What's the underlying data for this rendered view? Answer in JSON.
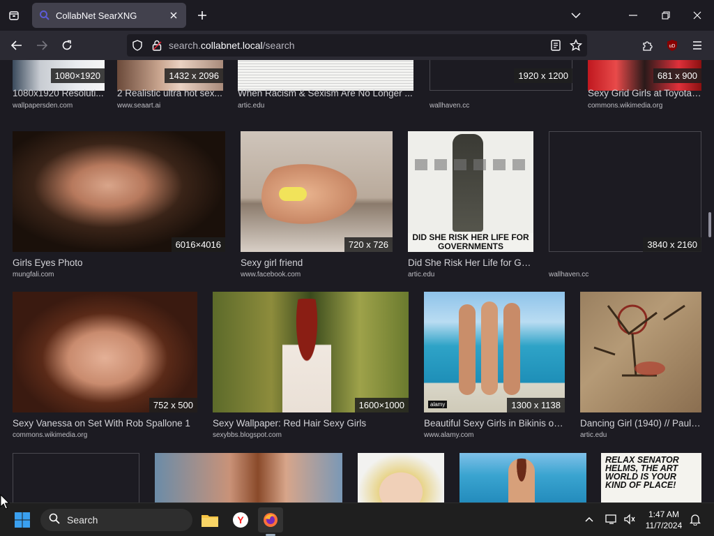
{
  "browser": {
    "tab_title": "CollabNet SearXNG",
    "url_prefix": "search.",
    "url_domain": "collabnet.local",
    "url_path": "/search"
  },
  "results_row1": [
    {
      "dim": "1080×1920",
      "title": "1080x1920 Resoluti...",
      "host": "wallpapersden.com"
    },
    {
      "dim": "1432 x 2096",
      "title": "2 Realistic ultra hot sex...",
      "host": "www.seaart.ai"
    },
    {
      "dim": "",
      "title": "When Racism & Sexism Are No Longer ...",
      "host": "artic.edu"
    },
    {
      "dim": "1920 x 1200",
      "title": "",
      "host": "wallhaven.cc"
    },
    {
      "dim": "681 x 900",
      "title": "Sexy Grid Girls at Toyota ...",
      "host": "commons.wikimedia.org"
    }
  ],
  "results_row2": [
    {
      "dim": "6016×4016",
      "title": "Girls Eyes Photo",
      "host": "mungfali.com"
    },
    {
      "dim": "720 x 726",
      "title": "Sexy girl friend",
      "host": "www.facebook.com"
    },
    {
      "dim": "",
      "title": "Did She Risk Her Life for Go...",
      "host": "artic.edu",
      "poster_text": "DID SHE RISK HER LIFE FOR GOVERNMENTS"
    },
    {
      "dim": "3840 x 2160",
      "title": "",
      "host": "wallhaven.cc"
    }
  ],
  "results_row3": [
    {
      "dim": "752 x 500",
      "title": "Sexy Vanessa on Set With Rob Spallone 1",
      "host": "commons.wikimedia.org"
    },
    {
      "dim": "1600×1000",
      "title": "Sexy Wallpaper: Red Hair Sexy Girls",
      "host": "sexybbs.blogspot.com"
    },
    {
      "dim": "1300 x 1138",
      "title": "Beautiful Sexy Girls in Bikinis on...",
      "host": "www.alamy.com",
      "watermark": "alamy"
    },
    {
      "dim": "",
      "title": "Dancing Girl (1940) // Paul ...",
      "host": "artic.edu"
    }
  ],
  "results_row4": [
    {
      "poster_text": "RELAX SENATOR HELMS, THE ART WORLD IS YOUR KIND OF PLACE!"
    }
  ],
  "taskbar": {
    "search_label": "Search",
    "time": "1:47 AM",
    "date": "11/7/2024"
  },
  "colors": {
    "accent": "#5b5bd6",
    "tab_bg": "#42414d",
    "nav_bg": "#2b2a33",
    "page_bg": "#1c1b22"
  },
  "icons": {
    "tab_list": "tab-list-icon",
    "new_tab": "plus-icon",
    "back": "back-arrow-icon",
    "forward": "forward-arrow-icon",
    "reload": "reload-icon",
    "shield": "shield-icon",
    "lock": "lock-icon",
    "reader": "reader-view-icon",
    "bookmark": "star-icon",
    "extensions": "puzzle-icon",
    "ublock": "ublock-icon",
    "menu": "hamburger-menu-icon"
  }
}
